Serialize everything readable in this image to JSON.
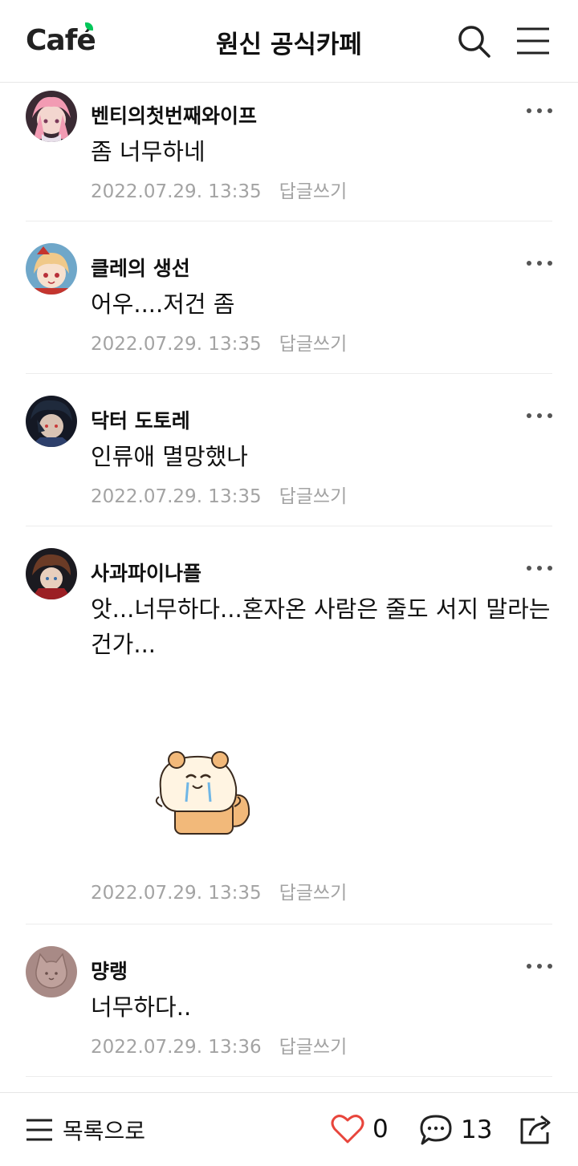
{
  "header": {
    "logo_text": "Caf",
    "logo_accent": "é",
    "title": "원신 공식카페"
  },
  "comments": [
    {
      "nickname": "벤티의첫번째와이프",
      "text": "좀 너무하네",
      "date": "2022.07.29. 13:35",
      "reply": "답글쓰기"
    },
    {
      "nickname": "클레의 생선",
      "text": "어우....저건 좀",
      "date": "2022.07.29. 13:35",
      "reply": "답글쓰기"
    },
    {
      "nickname": "닥터 도토레",
      "text": "인류애 멸망했나",
      "date": "2022.07.29. 13:35",
      "reply": "답글쓰기"
    },
    {
      "nickname": "사과파이나플",
      "text": "앗...너무하다...혼자온 사람은 줄도 서지 말라는건가...",
      "date": "2022.07.29. 13:35",
      "reply": "답글쓰기"
    },
    {
      "nickname": "먕랭",
      "text": "너무하다..",
      "date": "2022.07.29. 13:36",
      "reply": "답글쓰기"
    }
  ],
  "bottom_bar": {
    "list_label": "목록으로",
    "like_count": "0",
    "comment_count": "13"
  },
  "colors": {
    "brand_green": "#03c75a",
    "like_red": "#e8453c",
    "meta_gray": "#a3a3a3"
  }
}
